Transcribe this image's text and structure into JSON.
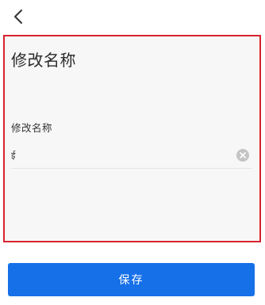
{
  "header": {
    "back_icon": "chevron-left-icon"
  },
  "form": {
    "title": "修改名称",
    "field_label": "修改名称",
    "name_value": "ई",
    "clear_icon": "clear-circle-icon"
  },
  "footer": {
    "save_label": "保存"
  },
  "colors": {
    "accent": "#1670e8",
    "highlight": "#d9232e",
    "panel_bg": "#f7f7f7"
  }
}
